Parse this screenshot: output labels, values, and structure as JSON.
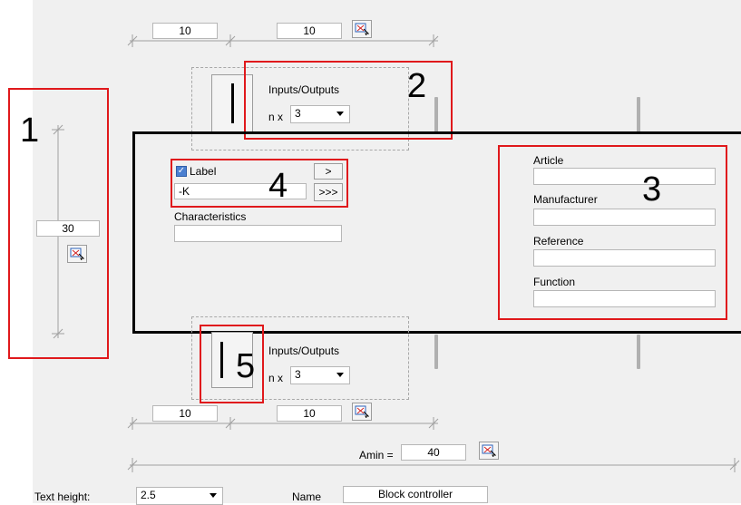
{
  "top_dims": {
    "left_value": "10",
    "right_value": "10"
  },
  "side_dim": {
    "value": "30"
  },
  "io_top": {
    "label": "Inputs/Outputs",
    "n_label": "n x",
    "count": "3"
  },
  "io_bottom": {
    "label": "Inputs/Outputs",
    "n_label": "n x",
    "count": "3"
  },
  "bottom_dims": {
    "left_value": "10",
    "right_value": "10"
  },
  "label_block": {
    "checkbox_label": "Label",
    "value": "-K",
    "next_label": ">",
    "more_label": ">>>",
    "characteristics_label": "Characteristics",
    "characteristics_value": ""
  },
  "properties": {
    "article_label": "Article",
    "manufacturer_label": "Manufacturer",
    "reference_label": "Reference",
    "function_label": "Function"
  },
  "amin": {
    "label": "Amin =",
    "value": "40"
  },
  "footer": {
    "text_height_label": "Text height:",
    "text_height_value": "2.5",
    "name_label": "Name",
    "name_value": "Block controller"
  },
  "callouts": {
    "one": "1",
    "two": "2",
    "three": "3",
    "four": "4",
    "five": "5"
  },
  "colors": {
    "callout_red": "#e0191c",
    "panel_bg": "#f0f0f0",
    "checkbox_blue": "#4a7fd0"
  },
  "icons": {
    "pick": "pick-dimension-icon"
  }
}
